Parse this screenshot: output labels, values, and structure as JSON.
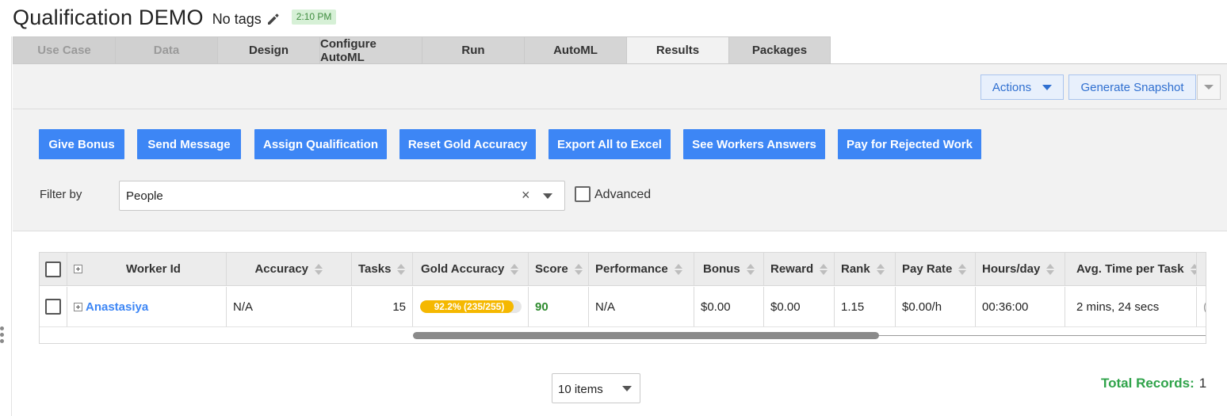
{
  "header": {
    "title": "Qualification DEMO",
    "tags": "No tags",
    "time": "2:10 PM"
  },
  "tabs": [
    {
      "label": "Use Case",
      "state": "disabled"
    },
    {
      "label": "Data",
      "state": "disabled"
    },
    {
      "label": "Design",
      "state": "normal"
    },
    {
      "label": "Configure AutoML",
      "state": "normal"
    },
    {
      "label": "Run",
      "state": "normal"
    },
    {
      "label": "AutoML",
      "state": "normal"
    },
    {
      "label": "Results",
      "state": "active"
    },
    {
      "label": "Packages",
      "state": "normal"
    }
  ],
  "toolbar": {
    "actions_label": "Actions",
    "snapshot_label": "Generate Snapshot"
  },
  "action_buttons": [
    "Give Bonus",
    "Send Message",
    "Assign Qualification",
    "Reset Gold Accuracy",
    "Export All to Excel",
    "See Workers Answers",
    "Pay for Rejected Work"
  ],
  "filter": {
    "label": "Filter by",
    "value": "People",
    "clear_glyph": "×",
    "advanced_label": "Advanced"
  },
  "grid": {
    "columns": {
      "worker_id": "Worker Id",
      "accuracy": "Accuracy",
      "tasks": "Tasks",
      "gold_accuracy": "Gold Accuracy",
      "score": "Score",
      "performance": "Performance",
      "bonus": "Bonus",
      "reward": "Reward",
      "rank": "Rank",
      "pay_rate": "Pay Rate",
      "hours_day": "Hours/day",
      "avg_time": "Avg. Time per Task"
    },
    "rows": [
      {
        "worker_id": "Anastasiya",
        "accuracy": "N/A",
        "tasks": "15",
        "gold_accuracy": "92.2% (235/255)",
        "gold_fraction": 0.922,
        "score": "90",
        "performance": "N/A",
        "bonus": "$0.00",
        "reward": "$0.00",
        "rank": "1.15",
        "pay_rate": "$0.00/h",
        "hours_day": "00:36:00",
        "avg_time": "2 mins, 24 secs",
        "next_col_partial": "("
      }
    ]
  },
  "pager": {
    "page_size": "10 items"
  },
  "total": {
    "label": "Total Records:",
    "value": "1"
  },
  "colors": {
    "primary_button": "#3d86f5",
    "gold_bar": "#f5b800",
    "score_green": "#2e8b2e",
    "total_green": "#2fa34a",
    "time_badge_bg": "#d6f0d6"
  }
}
